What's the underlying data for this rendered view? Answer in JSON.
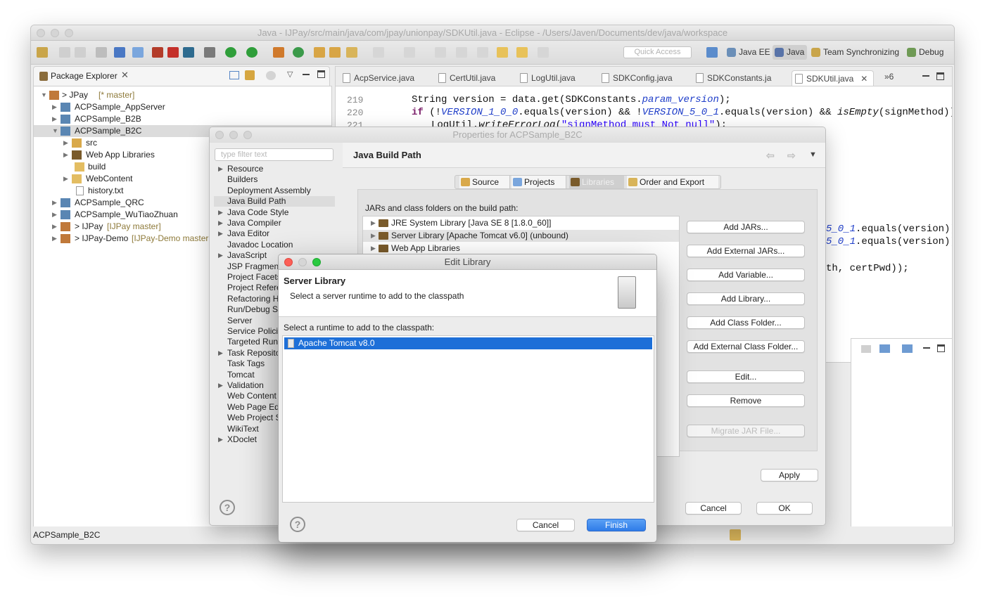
{
  "window": {
    "title": "Java - IJPay/src/main/java/com/jpay/unionpay/SDKUtil.java - Eclipse - /Users/Javen/Documents/dev/java/workspace"
  },
  "toolbar": {
    "quick_access": "Quick Access",
    "perspectives": [
      "Java EE",
      "Java",
      "Team Synchronizing",
      "Debug"
    ]
  },
  "package_explorer": {
    "title": "Package Explorer",
    "tree": [
      {
        "label": "> JPay",
        "decor": "[* master]"
      },
      {
        "label": "ACPSample_AppServer",
        "decor": ""
      },
      {
        "label": "ACPSample_B2B",
        "decor": ""
      },
      {
        "label": "ACPSample_B2C",
        "decor": ""
      },
      {
        "label": "src",
        "decor": ""
      },
      {
        "label": "Web App Libraries",
        "decor": ""
      },
      {
        "label": "build",
        "decor": ""
      },
      {
        "label": "WebContent",
        "decor": ""
      },
      {
        "label": "history.txt",
        "decor": ""
      },
      {
        "label": "ACPSample_QRC",
        "decor": ""
      },
      {
        "label": "ACPSample_WuTiaoZhuan",
        "decor": ""
      },
      {
        "label": "> IJPay",
        "decor": "[IJPay master]"
      },
      {
        "label": "> IJPay-Demo",
        "decor": "[IJPay-Demo master"
      }
    ]
  },
  "editor": {
    "tabs": [
      "AcpService.java",
      "CertUtil.java",
      "LogUtil.java",
      "SDKConfig.java",
      "SDKConstants.ja",
      "SDKUtil.java"
    ],
    "overflow_count": "»6",
    "line_numbers": [
      "219",
      "220",
      "221"
    ],
    "partial_right_1": "5_0_1.equals(version))",
    "partial_right_2": "5_0_1.equals(version))",
    "partial_right_3": "th, certPwd));"
  },
  "status": {
    "text": "ACPSample_B2C"
  },
  "properties_dialog": {
    "title": "Properties for ACPSample_B2C",
    "filter_placeholder": "type filter text",
    "nav": [
      {
        "label": "Resource",
        "expand": true
      },
      {
        "label": "Builders",
        "expand": false
      },
      {
        "label": "Deployment Assembly",
        "expand": false
      },
      {
        "label": "Java Build Path",
        "expand": false
      },
      {
        "label": "Java Code Style",
        "expand": true
      },
      {
        "label": "Java Compiler",
        "expand": true
      },
      {
        "label": "Java Editor",
        "expand": true
      },
      {
        "label": "Javadoc Location",
        "expand": false
      },
      {
        "label": "JavaScript",
        "expand": true
      },
      {
        "label": "JSP Fragment",
        "expand": false
      },
      {
        "label": "Project Facets",
        "expand": false
      },
      {
        "label": "Project Refere",
        "expand": false
      },
      {
        "label": "Refactoring H",
        "expand": false
      },
      {
        "label": "Run/Debug Se",
        "expand": false
      },
      {
        "label": "Server",
        "expand": false
      },
      {
        "label": "Service Polici",
        "expand": false
      },
      {
        "label": "Targeted Run",
        "expand": false
      },
      {
        "label": "Task Reposito",
        "expand": true
      },
      {
        "label": "Task Tags",
        "expand": false
      },
      {
        "label": "Tomcat",
        "expand": false
      },
      {
        "label": "Validation",
        "expand": true
      },
      {
        "label": "Web Content",
        "expand": false
      },
      {
        "label": "Web Page Edi",
        "expand": false
      },
      {
        "label": "Web Project S",
        "expand": false
      },
      {
        "label": "WikiText",
        "expand": false
      },
      {
        "label": "XDoclet",
        "expand": true
      }
    ],
    "page_title": "Java Build Path",
    "tabs": [
      "Source",
      "Projects",
      "Libraries",
      "Order and Export"
    ],
    "jars_label": "JARs and class folders on the build path:",
    "jars": [
      "JRE System Library [Java SE 8 [1.8.0_60]]",
      "Server Library [Apache Tomcat v6.0] (unbound)",
      "Web App Libraries"
    ],
    "buttons": {
      "add_jars": "Add JARs...",
      "add_external_jars": "Add External JARs...",
      "add_variable": "Add Variable...",
      "add_library": "Add Library...",
      "add_class_folder": "Add Class Folder...",
      "add_external_class_folder": "Add External Class Folder...",
      "edit": "Edit...",
      "remove": "Remove",
      "migrate": "Migrate JAR File...",
      "apply": "Apply",
      "cancel": "Cancel",
      "ok": "OK"
    }
  },
  "edit_library": {
    "title": "Edit Library",
    "banner_title": "Server Library",
    "banner_desc": "Select a server runtime to add to the classpath",
    "list_label": "Select a runtime to add to the classpath:",
    "runtime": "Apache Tomcat v8.0",
    "cancel": "Cancel",
    "finish": "Finish"
  }
}
